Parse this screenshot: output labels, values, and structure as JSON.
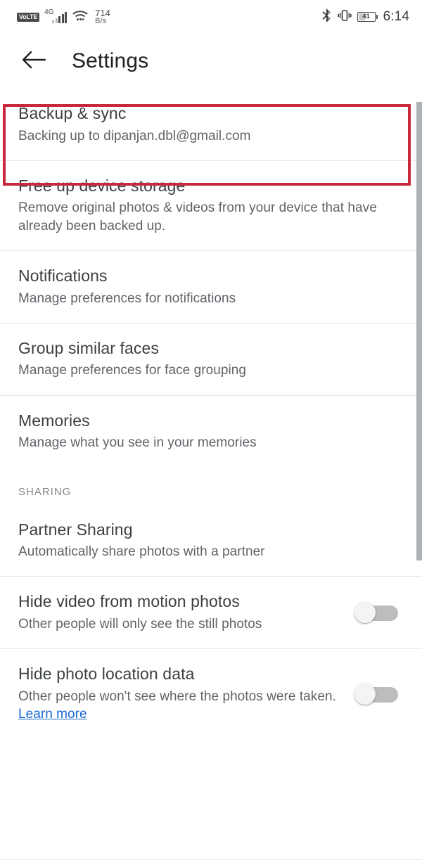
{
  "status_bar": {
    "volte_label": "VoLTE",
    "network_type": "4G",
    "data_speed_value": "714",
    "data_speed_unit": "B/s",
    "bluetooth_icon": "bluetooth-icon",
    "vibrate_icon": "vibrate-icon",
    "battery_percent": "41",
    "time": "6:14"
  },
  "app_bar": {
    "back_icon": "back-arrow-icon",
    "title": "Settings"
  },
  "settings": {
    "items": [
      {
        "title": "Backup & sync",
        "subtitle": "Backing up to dipanjan.dbl@gmail.com",
        "highlighted": true
      },
      {
        "title": "Free up device storage",
        "subtitle": "Remove original photos & videos from your device that have already been backed up."
      },
      {
        "title": "Notifications",
        "subtitle": "Manage preferences for notifications"
      },
      {
        "title": "Group similar faces",
        "subtitle": "Manage preferences for face grouping"
      },
      {
        "title": "Memories",
        "subtitle": "Manage what you see in your memories"
      }
    ],
    "sharing_section": {
      "header": "SHARING",
      "items": [
        {
          "title": "Partner Sharing",
          "subtitle": "Automatically share photos with a partner"
        },
        {
          "title": "Hide video from motion photos",
          "subtitle": "Other people will only see the still photos",
          "toggle_state": "off"
        },
        {
          "title": "Hide photo location data",
          "subtitle": "Other people won't see where the photos were taken.",
          "link_text": "Learn more",
          "toggle_state": "off"
        }
      ]
    }
  },
  "annotation": {
    "color": "#c9273d",
    "target": "Backup & sync"
  },
  "scrollbar": {
    "color": "#b0b3b5"
  }
}
